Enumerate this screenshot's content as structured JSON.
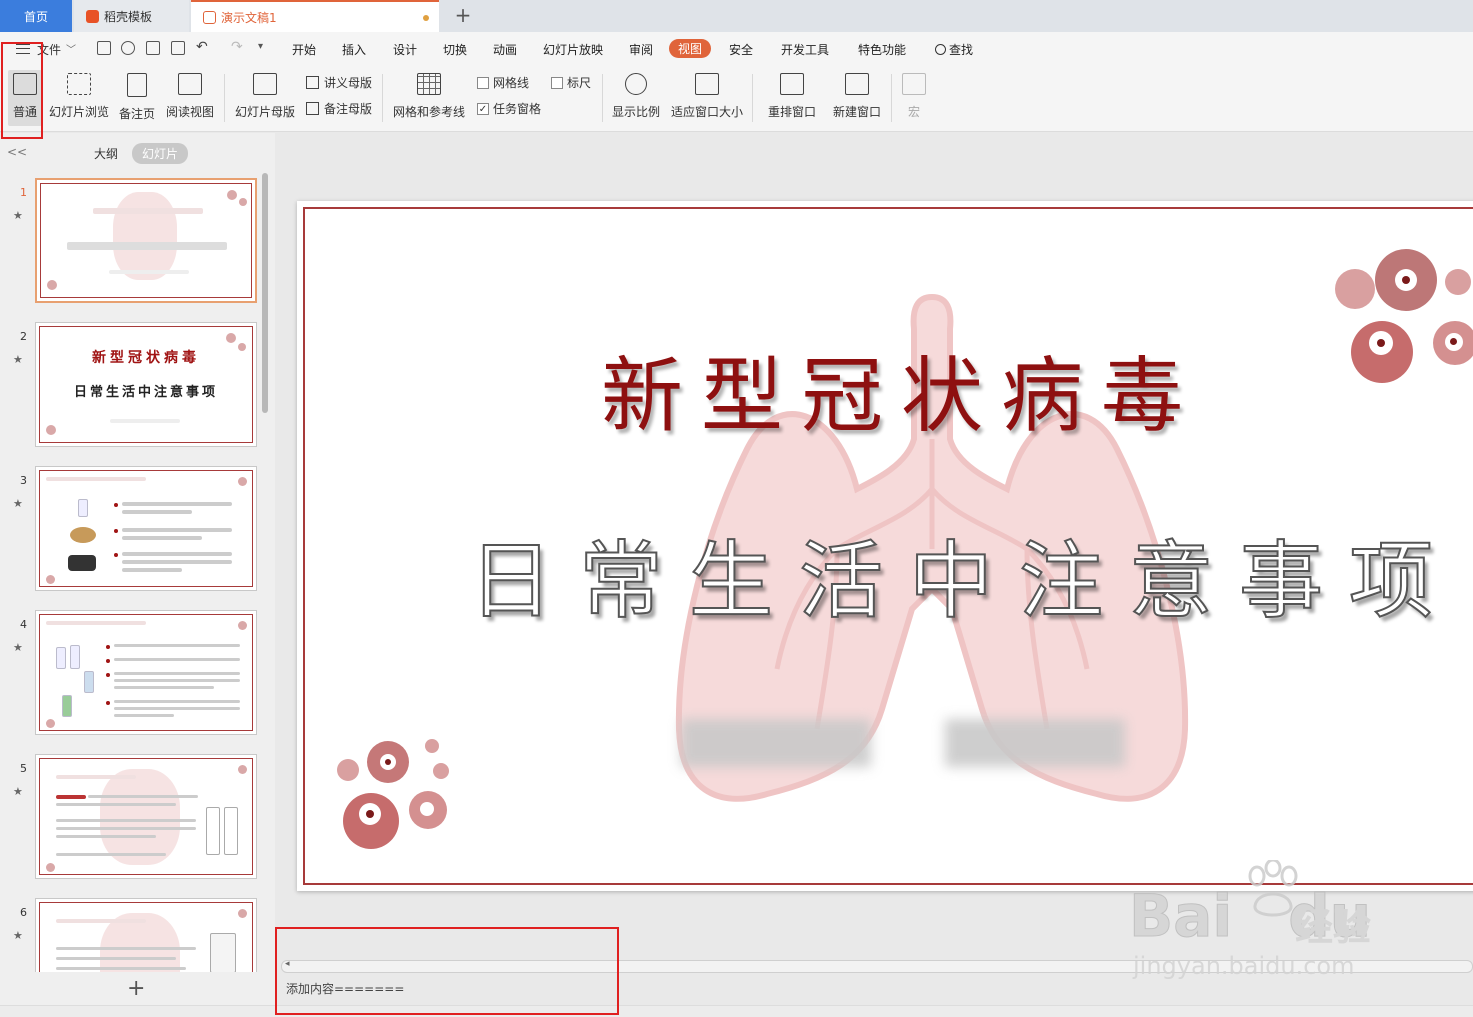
{
  "tabs": {
    "home": "首页",
    "template": "稻壳模板",
    "document": "演示文稿1",
    "add": "+"
  },
  "menu": {
    "file": "文件",
    "items": [
      "开始",
      "插入",
      "设计",
      "切换",
      "动画",
      "幻灯片放映",
      "审阅",
      "视图",
      "安全",
      "开发工具",
      "特色功能"
    ],
    "active": "视图",
    "search": "查找"
  },
  "toolbar": {
    "normal": "普通",
    "slide_browse": "幻灯片浏览",
    "notes_page": "备注页",
    "reading_view": "阅读视图",
    "slide_master": "幻灯片母版",
    "handout_master": "讲义母版",
    "notes_master": "备注母版",
    "grid_guides": "网格和参考线",
    "gridlines": "网格线",
    "ruler": "标尺",
    "task_pane": "任务窗格",
    "zoom": "显示比例",
    "fit_window": "适应窗口大小",
    "arrange": "重排窗口",
    "new_window": "新建窗口",
    "macro": "宏"
  },
  "panel": {
    "outline": "大纲",
    "slides": "幻灯片",
    "collapse": "<<",
    "add": "+"
  },
  "thumbnails": [
    {
      "num": "1"
    },
    {
      "num": "2",
      "title1": "新型冠状病毒",
      "title2": "日常生活中注意事项"
    },
    {
      "num": "3"
    },
    {
      "num": "4"
    },
    {
      "num": "5"
    },
    {
      "num": "6"
    }
  ],
  "slide": {
    "title": "新型冠状病毒",
    "subtitle": "日常生活中注意事项"
  },
  "notes": "添加内容=======",
  "watermark": {
    "brand": "Bai",
    "brand2": "du",
    "cn": "经验",
    "url": "jingyan.baidu.com"
  },
  "colors": {
    "accent": "#e0643a",
    "title_red": "#8e1010",
    "annotation": "#e02020"
  }
}
